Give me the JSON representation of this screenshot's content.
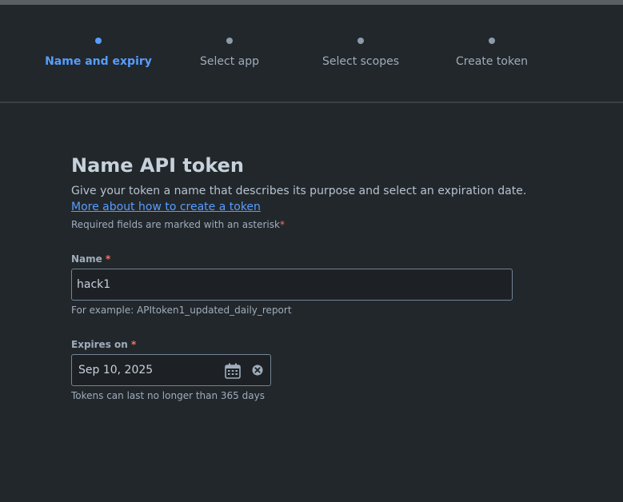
{
  "stepper": {
    "steps": [
      {
        "label": "Name and expiry",
        "active": true
      },
      {
        "label": "Select app",
        "active": false
      },
      {
        "label": "Select scopes",
        "active": false
      },
      {
        "label": "Create token",
        "active": false
      }
    ]
  },
  "form": {
    "title": "Name API token",
    "description": "Give your token a name that describes its purpose and select an expiration date.",
    "help_link": "More about how to create a token",
    "required_note": "Required fields are marked with an asterisk",
    "required_marker": "*",
    "name": {
      "label": "Name",
      "value": "hack1",
      "helper": "For example: APItoken1_updated_daily_report"
    },
    "expires": {
      "label": "Expires on",
      "value": "Sep 10, 2025",
      "helper": "Tokens can last no longer than 365 days"
    }
  },
  "icons": {
    "calendar": "calendar-icon",
    "clear": "clear-icon"
  },
  "colors": {
    "background": "#22272b",
    "accent": "#579dff",
    "required": "#f87168",
    "text": "#b6c2cf",
    "muted": "#9fadbc"
  }
}
